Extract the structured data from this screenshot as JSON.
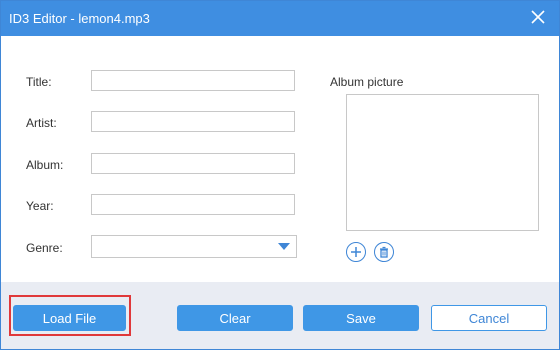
{
  "window": {
    "title": "ID3 Editor - lemon4.mp3"
  },
  "fields": {
    "title": {
      "label": "Title:",
      "value": ""
    },
    "artist": {
      "label": "Artist:",
      "value": ""
    },
    "album": {
      "label": "Album:",
      "value": ""
    },
    "year": {
      "label": "Year:",
      "value": ""
    },
    "genre": {
      "label": "Genre:",
      "value": ""
    }
  },
  "album_picture": {
    "label": "Album picture"
  },
  "footer": {
    "load_file": "Load File",
    "clear": "Clear",
    "save": "Save",
    "cancel": "Cancel"
  },
  "colors": {
    "accent": "#3f8ee1",
    "button": "#3f97e6",
    "footer_bg": "#e9ecf3",
    "highlight": "#e0383a"
  },
  "icons": [
    "close-icon",
    "chevron-down-icon",
    "plus-icon",
    "trash-icon"
  ]
}
